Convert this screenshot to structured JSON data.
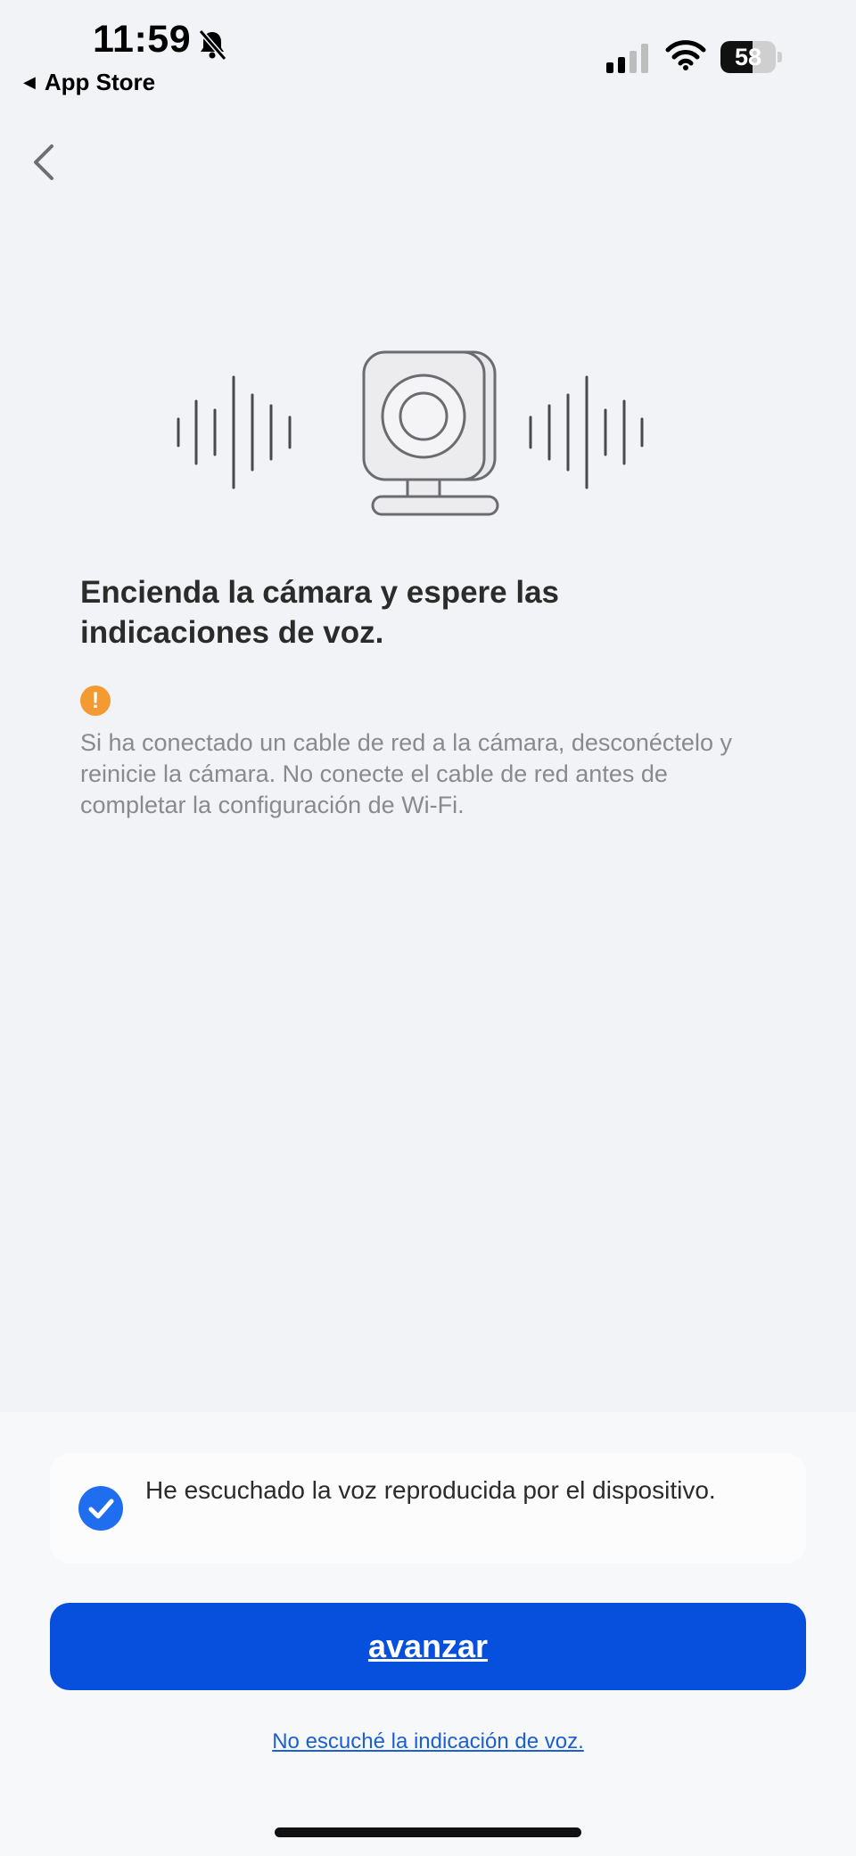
{
  "status_bar": {
    "time": "11:59",
    "back_app": "App Store",
    "battery": "58",
    "battery_level": 0.58
  },
  "heading": "Encienda la cámara y espere las indicaciones de voz.",
  "warning": {
    "icon_glyph": "!",
    "text": "Si ha conectado un cable de red a la cámara, desconéctelo y reinicie la cámara. No conecte el cable de red antes de completar la configuración de Wi-Fi."
  },
  "confirm": {
    "checked": true,
    "text": "He escuchado la voz reproducida por el dispositivo."
  },
  "primary_button": "avanzar",
  "secondary_link": "No escuché la indicación de voz.",
  "colors": {
    "accent": "#0750de",
    "warning": "#f49a33",
    "checkbox": "#1f6ef0",
    "link": "#1b5fd3"
  },
  "icons": {
    "bell": "bell-slash-icon",
    "nav_back": "chevron-left-icon",
    "illustration": "camera-with-sound-waves-icon"
  }
}
